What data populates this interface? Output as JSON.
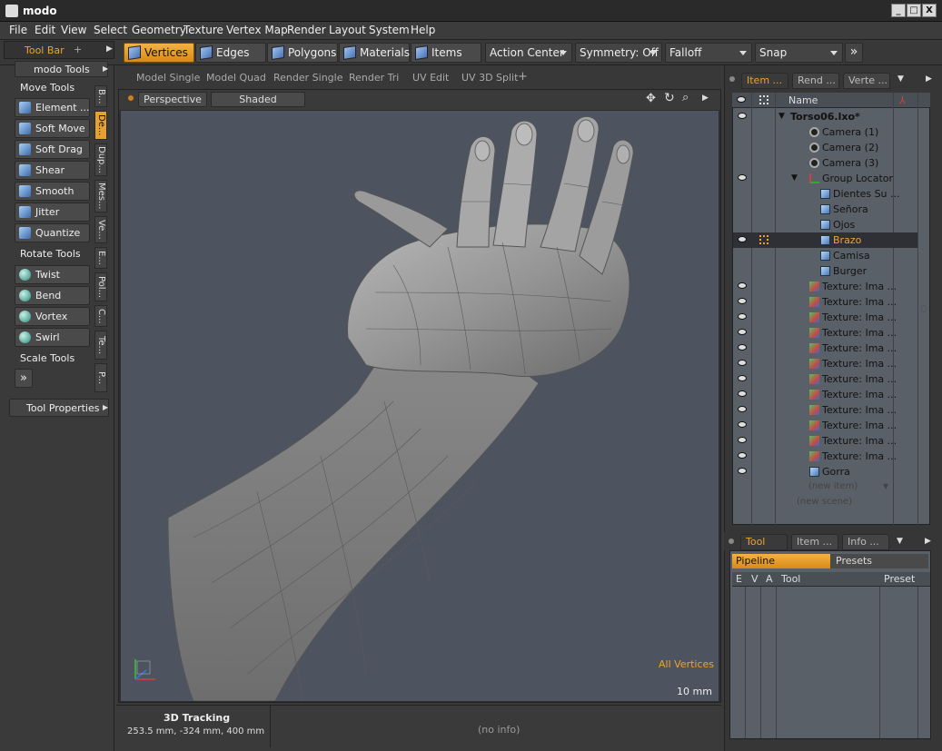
{
  "window": {
    "title": "modo",
    "minimize": "_",
    "maximize": "□",
    "close": "X"
  },
  "menu": [
    "File",
    "Edit",
    "View",
    "Select",
    "Geometry",
    "Texture",
    "Vertex Map",
    "Render",
    "Layout",
    "System",
    "Help"
  ],
  "toolbar": {
    "panel_tab": "Tool Bar",
    "modes": [
      "Vertices",
      "Edges",
      "Polygons",
      "Materials",
      "Items"
    ],
    "active_mode": "Vertices",
    "action_center": "Action Center",
    "symmetry": "Symmetry: Off",
    "falloff": "Falloff",
    "snap": "Snap",
    "more": "»"
  },
  "left": {
    "header": "modo Tools",
    "move_label": "Move Tools",
    "move_tools": [
      "Element ...",
      "Soft Move",
      "Soft Drag",
      "Shear",
      "Smooth",
      "Jitter",
      "Quantize"
    ],
    "rotate_label": "Rotate Tools",
    "rotate_tools": [
      "Twist",
      "Bend",
      "Vortex",
      "Swirl"
    ],
    "scale_label": "Scale Tools",
    "expand": "»",
    "tool_properties": "Tool Properties",
    "vertical_tabs": [
      "B...",
      "De...",
      "Dup...",
      "Mes...",
      "Ve...",
      "E...",
      "Pol...",
      "C...",
      "Te...",
      "P..."
    ]
  },
  "viewport": {
    "tabs": [
      "Model Single",
      "Model Quad",
      "Render Single",
      "Render Tri",
      "UV Edit",
      "UV 3D Split"
    ],
    "add_tab": "+",
    "projection": "Perspective",
    "shading": "Shaded",
    "selection_info": "All Vertices",
    "grid_size": "10 mm"
  },
  "status": {
    "title": "3D Tracking",
    "coords": "253.5 mm, -324 mm, 400 mm",
    "info": "(no info)"
  },
  "right": {
    "tabs": [
      "Item ...",
      "Rend ...",
      "Verte ..."
    ],
    "name_column": "Name",
    "items": [
      {
        "label": "Torso06.lxo*",
        "type": "scene",
        "indent": 0,
        "eye": true
      },
      {
        "label": "Camera (1)",
        "type": "cam",
        "indent": 1,
        "eye": false
      },
      {
        "label": "Camera (2)",
        "type": "cam",
        "indent": 1,
        "eye": false
      },
      {
        "label": "Camera (3)",
        "type": "cam",
        "indent": 1,
        "eye": false
      },
      {
        "label": "Group Locator",
        "type": "grp",
        "indent": 1,
        "eye": true
      },
      {
        "label": "Dientes Su ...",
        "type": "mesh",
        "indent": 2,
        "eye": false
      },
      {
        "label": "Señora",
        "type": "mesh",
        "indent": 2,
        "eye": false
      },
      {
        "label": "Ojos",
        "type": "mesh",
        "indent": 2,
        "eye": false
      },
      {
        "label": "Brazo",
        "type": "mesh",
        "indent": 2,
        "eye": true,
        "selected": true
      },
      {
        "label": "Camisa",
        "type": "mesh",
        "indent": 2,
        "eye": false
      },
      {
        "label": "Burger",
        "type": "mesh",
        "indent": 2,
        "eye": false
      },
      {
        "label": "Texture: Ima ...",
        "type": "tex",
        "indent": 1,
        "eye": true
      },
      {
        "label": "Texture: Ima ...",
        "type": "tex",
        "indent": 1,
        "eye": true
      },
      {
        "label": "Texture: Ima ...",
        "type": "tex",
        "indent": 1,
        "eye": true
      },
      {
        "label": "Texture: Ima ...",
        "type": "tex",
        "indent": 1,
        "eye": true
      },
      {
        "label": "Texture: Ima ...",
        "type": "tex",
        "indent": 1,
        "eye": true
      },
      {
        "label": "Texture: Ima ...",
        "type": "tex",
        "indent": 1,
        "eye": true
      },
      {
        "label": "Texture: Ima ...",
        "type": "tex",
        "indent": 1,
        "eye": true
      },
      {
        "label": "Texture: Ima ...",
        "type": "tex",
        "indent": 1,
        "eye": true
      },
      {
        "label": "Texture: Ima ...",
        "type": "tex",
        "indent": 1,
        "eye": true
      },
      {
        "label": "Texture: Ima ...",
        "type": "tex",
        "indent": 1,
        "eye": true
      },
      {
        "label": "Texture: Ima ...",
        "type": "tex",
        "indent": 1,
        "eye": true
      },
      {
        "label": "Texture: Ima ...",
        "type": "tex",
        "indent": 1,
        "eye": true
      },
      {
        "label": "Gorra",
        "type": "mesh",
        "indent": 1,
        "eye": true
      }
    ],
    "new_item": "(new item)",
    "new_scene": "(new scene)",
    "bottom_tabs": [
      "Tool",
      "Item ...",
      "Info ..."
    ],
    "pipeline": "Pipeline",
    "presets": "Presets",
    "tool_columns": [
      "E",
      "V",
      "A",
      "Tool",
      "Preset"
    ]
  },
  "colors": {
    "accent": "#f0a030",
    "viewport_bg": "#4d5460",
    "list_bg": "#5a6068"
  }
}
